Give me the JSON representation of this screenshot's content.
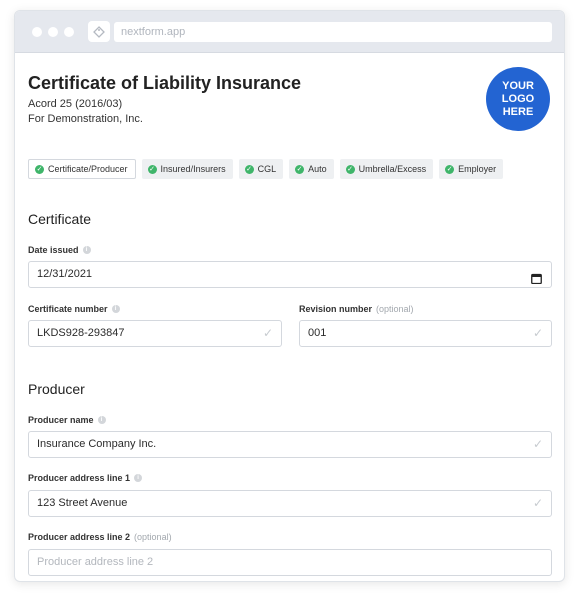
{
  "browser": {
    "url": "nextform.app"
  },
  "header": {
    "title": "Certificate of Liability Insurance",
    "form_code": "Acord 25 (2016/03)",
    "company": "For Demonstration, Inc.",
    "logo_lines": [
      "YOUR",
      "LOGO",
      "HERE"
    ]
  },
  "steps": [
    {
      "label": "Certificate/Producer",
      "active": true
    },
    {
      "label": "Insured/Insurers",
      "active": false
    },
    {
      "label": "CGL",
      "active": false
    },
    {
      "label": "Auto",
      "active": false
    },
    {
      "label": "Umbrella/Excess",
      "active": false
    },
    {
      "label": "Employer",
      "active": false
    }
  ],
  "certificate": {
    "section_title": "Certificate",
    "date_issued": {
      "label": "Date issued",
      "value": "12/31/2021"
    },
    "certificate_number": {
      "label": "Certificate number",
      "value": "LKDS928-293847"
    },
    "revision_number": {
      "label": "Revision number",
      "optional": "(optional)",
      "value": "001"
    }
  },
  "producer": {
    "section_title": "Producer",
    "name": {
      "label": "Producer name",
      "value": "Insurance Company Inc."
    },
    "address1": {
      "label": "Producer address line 1",
      "value": "123 Street Avenue"
    },
    "address2": {
      "label": "Producer address line 2",
      "optional": "(optional)",
      "placeholder": "Producer address line 2"
    }
  },
  "colors": {
    "accent": "#2364d2",
    "success": "#3fb56a"
  }
}
